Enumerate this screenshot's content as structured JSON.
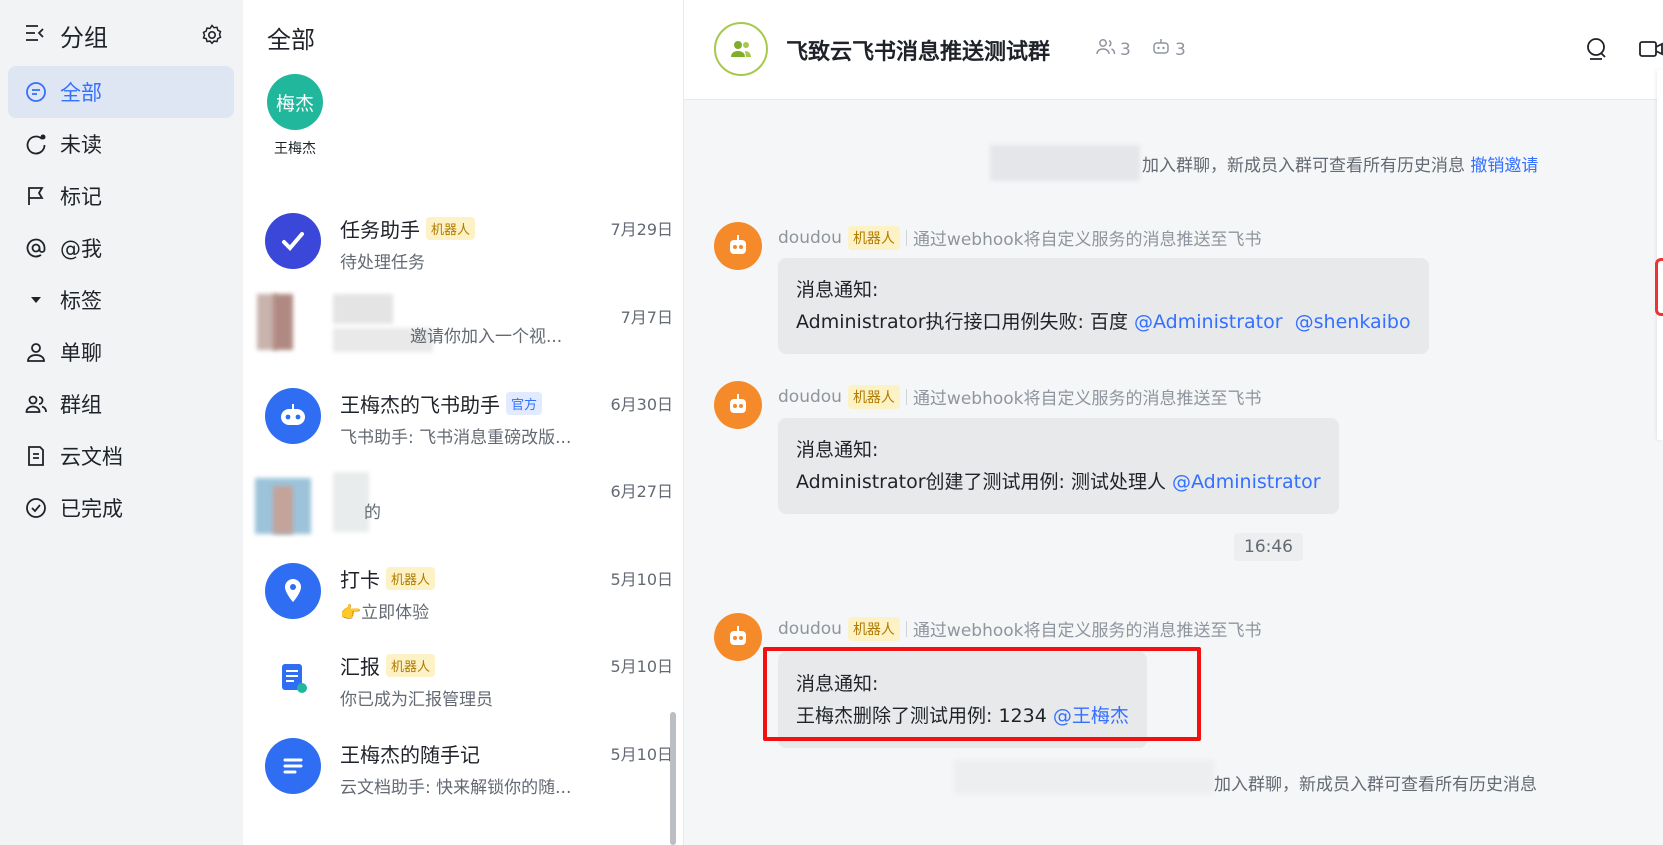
{
  "nav": {
    "title": "分组",
    "items": [
      {
        "label": "全部",
        "icon": "chat-bubble-icon"
      },
      {
        "label": "未读",
        "icon": "unread-icon"
      },
      {
        "label": "标记",
        "icon": "flag-icon"
      },
      {
        "label": "@我",
        "icon": "at-icon"
      },
      {
        "label": "标签",
        "icon": "caret-down-icon"
      },
      {
        "label": "单聊",
        "icon": "person-icon"
      },
      {
        "label": "群组",
        "icon": "group-icon"
      },
      {
        "label": "云文档",
        "icon": "document-icon"
      },
      {
        "label": "已完成",
        "icon": "check-circle-icon"
      }
    ]
  },
  "list": {
    "title": "全部",
    "pinned": {
      "avatar_text": "梅杰",
      "name": "王梅杰"
    },
    "conversations": [
      {
        "name": "任务助手",
        "tag": "机器人",
        "date": "7月29日",
        "preview": "待处理任务"
      },
      {
        "name": "",
        "tag": "",
        "date": "7月7日",
        "preview": "邀请你加入一个视..."
      },
      {
        "name": "王梅杰的飞书助手",
        "tag": "官方",
        "date": "6月30日",
        "preview": "飞书助手: 飞书消息重磅改版..."
      },
      {
        "name": "",
        "tag": "",
        "date": "6月27日",
        "preview": "的"
      },
      {
        "name": "打卡",
        "tag": "机器人",
        "date": "5月10日",
        "preview": "👉立即体验"
      },
      {
        "name": "汇报",
        "tag": "机器人",
        "date": "5月10日",
        "preview": "你已成为汇报管理员"
      },
      {
        "name": "王梅杰的随手记",
        "tag": "",
        "date": "5月10日",
        "preview": "云文档助手: 快来解锁你的随..."
      }
    ]
  },
  "chat": {
    "title": "飞致云飞书消息推送测试群",
    "member_count": "3",
    "bot_count": "3",
    "system_1": {
      "text": "加入群聊，新成员入群可查看所有历史消息",
      "link": "撤销邀请"
    },
    "messages": [
      {
        "sender": "doudou",
        "tag": "机器人",
        "desc": "通过webhook将自定义服务的消息推送至飞书",
        "line1": "消息通知:",
        "line2": "Administrator执行接口用例失败: 百度",
        "mentions": [
          "@Administrator",
          "@shenkaibo"
        ]
      },
      {
        "sender": "doudou",
        "tag": "机器人",
        "desc": "通过webhook将自定义服务的消息推送至飞书",
        "line1": "消息通知:",
        "line2": "Administrator创建了测试用例: 测试处理人",
        "mentions": [
          "@Administrator"
        ]
      },
      {
        "sender": "doudou",
        "tag": "机器人",
        "desc": "通过webhook将自定义服务的消息推送至飞书",
        "line1": "消息通知:",
        "line2": "王梅杰删除了测试用例: 1234",
        "mentions": [
          "@王梅杰"
        ]
      }
    ],
    "time": "16:46",
    "system_2": {
      "text": "加入群聊，新成员入群可查看所有历史消息"
    }
  },
  "colors": {
    "accent": "#3370ff",
    "highlight": "#f21010",
    "bot_avatar": "#f58a2b"
  }
}
